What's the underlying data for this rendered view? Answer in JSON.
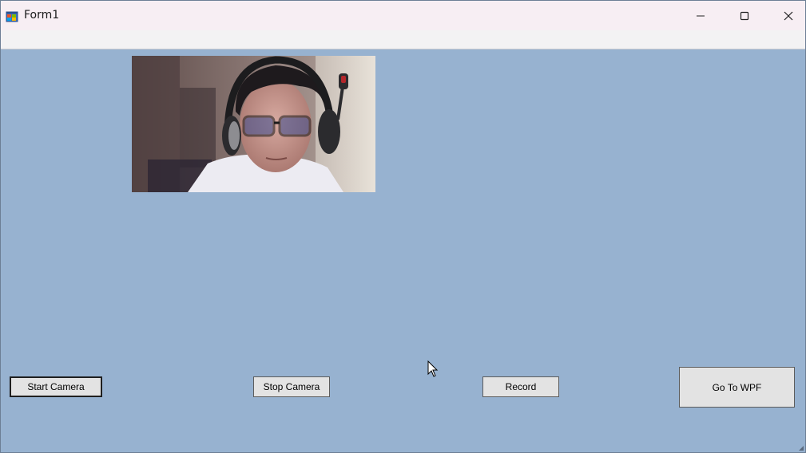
{
  "window": {
    "title": "Form1",
    "icons": {
      "app": "winforms-app-icon",
      "minimize": "minimize-icon",
      "maximize": "maximize-icon",
      "close": "close-icon"
    }
  },
  "buttons": {
    "start_camera": "Start Camera",
    "stop_camera": "Stop Camera",
    "record": "Record",
    "go_to_wpf": "Go To WPF"
  },
  "colors": {
    "form_background": "#97b2d0",
    "titlebar": "#f7eef3",
    "button_face": "#e3e3e3"
  }
}
